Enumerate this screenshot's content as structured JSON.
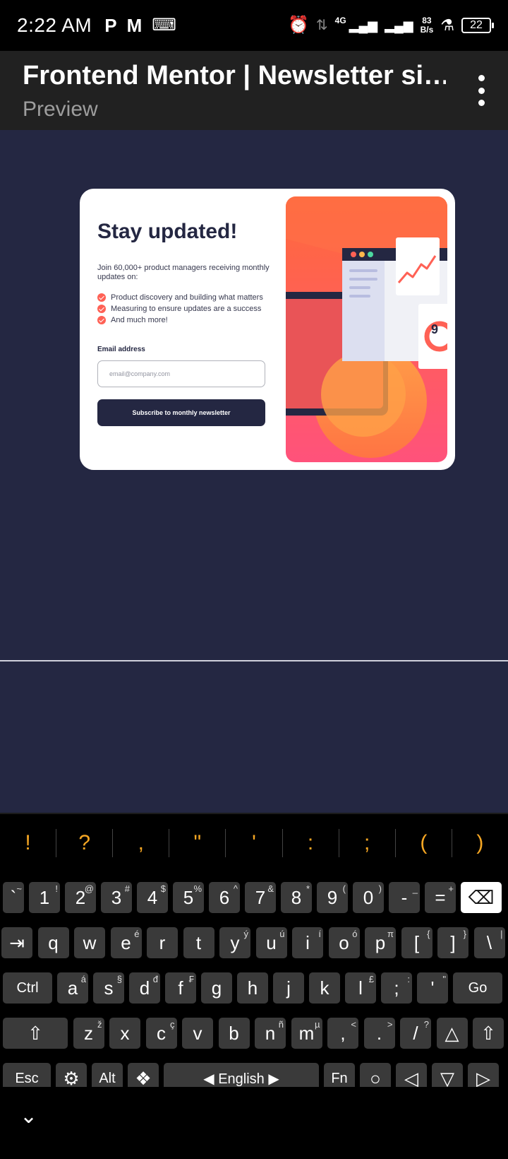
{
  "status_bar": {
    "time": "2:22 AM",
    "left_icons": [
      "p-icon",
      "gmail-icon",
      "keyboard-icon"
    ],
    "network": "4G",
    "speed_value": "83",
    "speed_unit": "B/s",
    "battery": "22"
  },
  "header": {
    "title": "Frontend Mentor | Newsletter si…",
    "subtitle": "Preview"
  },
  "card": {
    "title": "Stay updated!",
    "description": "Join 60,000+ product managers receiving monthly updates on:",
    "benefits": [
      "Product discovery and building what matters",
      "Measuring to ensure updates are a success",
      "And much more!"
    ],
    "email_label": "Email address",
    "email_placeholder": "email@company.com",
    "button_label": "Subscribe to monthly newsletter",
    "illustration_badge": "9"
  },
  "colors": {
    "preview_bg": "#242742",
    "accent": "#ff6155",
    "keyboard_suggestion": "#f5a623"
  },
  "keyboard": {
    "suggestions": [
      "!",
      "?",
      ",",
      "\"",
      "'",
      ":",
      ";",
      "(",
      ")"
    ],
    "row1": [
      {
        "main": "`",
        "hint": "~"
      },
      {
        "main": "1",
        "hint": "!"
      },
      {
        "main": "2",
        "hint": "@"
      },
      {
        "main": "3",
        "hint": "#"
      },
      {
        "main": "4",
        "hint": "$"
      },
      {
        "main": "5",
        "hint": "%"
      },
      {
        "main": "6",
        "hint": "^"
      },
      {
        "main": "7",
        "hint": "&"
      },
      {
        "main": "8",
        "hint": "*"
      },
      {
        "main": "9",
        "hint": "("
      },
      {
        "main": "0",
        "hint": ")"
      },
      {
        "main": "-",
        "hint": "_"
      },
      {
        "main": "=",
        "hint": "+"
      },
      {
        "main": "⌫",
        "hint": ""
      }
    ],
    "row2": [
      {
        "main": "⇥",
        "hint": ""
      },
      {
        "main": "q",
        "hint": ""
      },
      {
        "main": "w",
        "hint": ""
      },
      {
        "main": "e",
        "hint": "é"
      },
      {
        "main": "r",
        "hint": ""
      },
      {
        "main": "t",
        "hint": ""
      },
      {
        "main": "y",
        "hint": "ý"
      },
      {
        "main": "u",
        "hint": "ú"
      },
      {
        "main": "i",
        "hint": "í"
      },
      {
        "main": "o",
        "hint": "ó"
      },
      {
        "main": "p",
        "hint": "π"
      },
      {
        "main": "[",
        "hint": "{"
      },
      {
        "main": "]",
        "hint": "}"
      },
      {
        "main": "\\",
        "hint": "|"
      }
    ],
    "row3": [
      {
        "main": "Ctrl",
        "hint": ""
      },
      {
        "main": "a",
        "hint": "á"
      },
      {
        "main": "s",
        "hint": "§"
      },
      {
        "main": "d",
        "hint": "đ"
      },
      {
        "main": "f",
        "hint": "₣"
      },
      {
        "main": "g",
        "hint": ""
      },
      {
        "main": "h",
        "hint": ""
      },
      {
        "main": "j",
        "hint": ""
      },
      {
        "main": "k",
        "hint": ""
      },
      {
        "main": "l",
        "hint": "£"
      },
      {
        "main": ";",
        "hint": ":"
      },
      {
        "main": "'",
        "hint": "\""
      },
      {
        "main": "Go",
        "hint": ""
      }
    ],
    "row4": [
      {
        "main": "⇧",
        "hint": ""
      },
      {
        "main": "z",
        "hint": "ž"
      },
      {
        "main": "x",
        "hint": ""
      },
      {
        "main": "c",
        "hint": "ç"
      },
      {
        "main": "v",
        "hint": ""
      },
      {
        "main": "b",
        "hint": ""
      },
      {
        "main": "n",
        "hint": "ñ"
      },
      {
        "main": "m",
        "hint": "µ"
      },
      {
        "main": ",",
        "hint": "<"
      },
      {
        "main": ".",
        "hint": ">"
      },
      {
        "main": "/",
        "hint": "?"
      },
      {
        "main": "△",
        "hint": ""
      },
      {
        "main": "⇧",
        "hint": ""
      }
    ],
    "row5": [
      {
        "main": "Esc",
        "hint": ""
      },
      {
        "main": "⚙",
        "hint": ""
      },
      {
        "main": "Alt",
        "hint": ""
      },
      {
        "main": "❖",
        "hint": ""
      },
      {
        "main": "English",
        "hint": ""
      },
      {
        "main": "Fn",
        "hint": ""
      },
      {
        "main": "○",
        "hint": ""
      },
      {
        "main": "◁",
        "hint": ""
      },
      {
        "main": "▽",
        "hint": ""
      },
      {
        "main": "▷",
        "hint": ""
      }
    ]
  },
  "nav": {
    "hide_keyboard_icon": "chevron-down-icon"
  }
}
